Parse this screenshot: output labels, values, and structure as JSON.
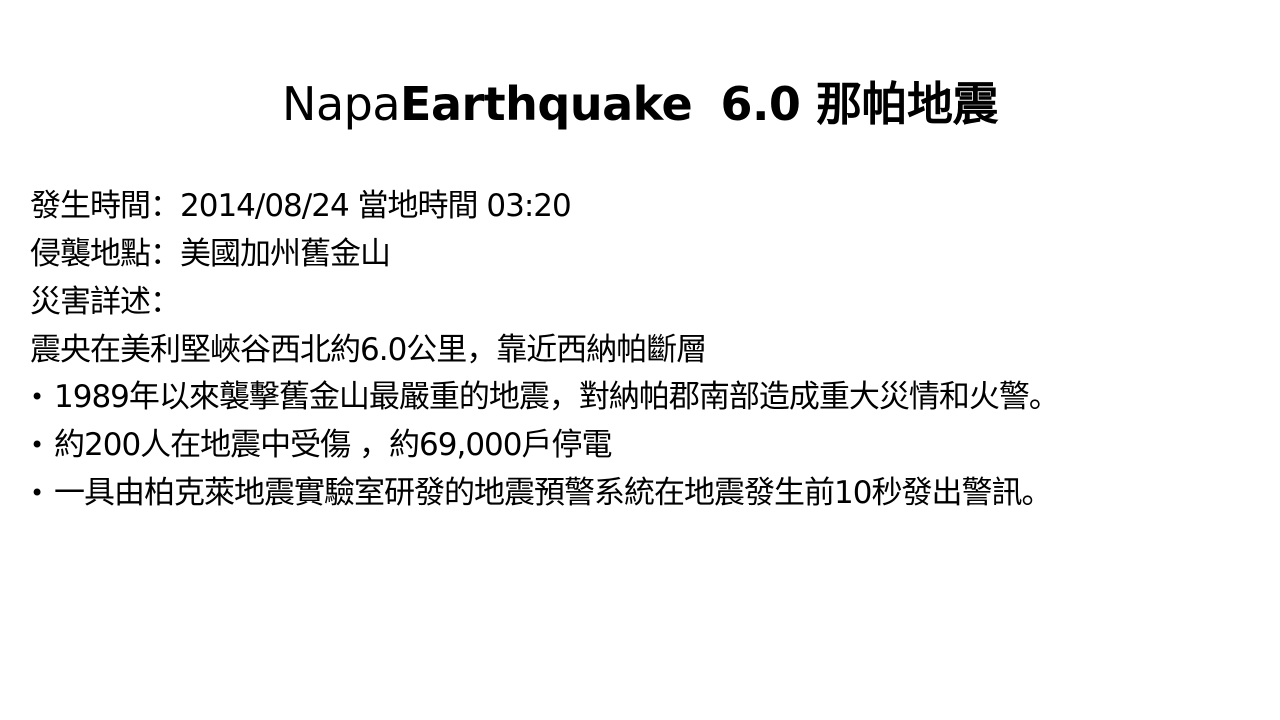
{
  "slide": {
    "title_part1": "Napa",
    "title_part2": "Earthquake",
    "title_part3": "6.0 那帕地震",
    "lines": {
      "time": "發生時間：2014/08/24 當地時間 03:20",
      "location": "侵襲地點：美國加州舊金山",
      "details_label": "災害詳述：",
      "epicenter": "震央在美利堅峽谷西北約6.0公里，靠近西納帕斷層"
    },
    "bullets": [
      "1989年以來襲擊舊金山最嚴重的地震，對納帕郡南部造成重大災情和火警。",
      "約200人在地震中受傷 ，約69,000戶停電",
      "一具由柏克萊地震實驗室研發的地震預警系統在地震發生前10秒發出警訊。"
    ],
    "bullet_symbol": "•"
  }
}
